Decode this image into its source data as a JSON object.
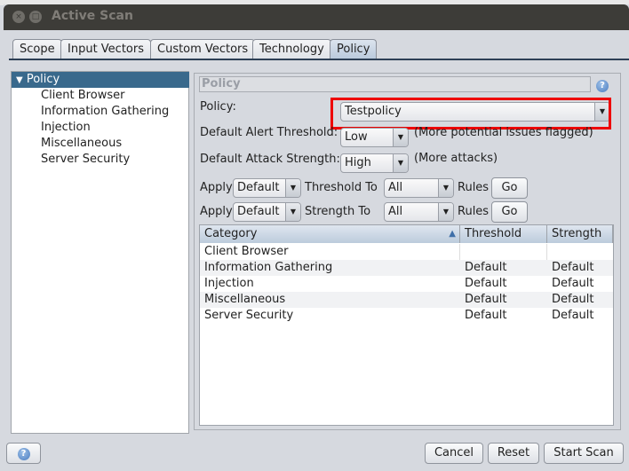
{
  "window": {
    "title": "Active Scan",
    "close_icon": "×",
    "maximize_icon": "□"
  },
  "tabs": [
    {
      "label": "Scope"
    },
    {
      "label": "Input Vectors"
    },
    {
      "label": "Custom Vectors"
    },
    {
      "label": "Technology"
    },
    {
      "label": "Policy",
      "active": true
    }
  ],
  "tree": {
    "root": "Policy",
    "expand_icon": "▼",
    "children": [
      "Client Browser",
      "Information Gathering",
      "Injection",
      "Miscellaneous",
      "Server Security"
    ]
  },
  "panel": {
    "header": "Policy",
    "help_icon": "?",
    "policy_label": "Policy:",
    "policy_value": "Testpolicy",
    "threshold_label": "Default Alert Threshold:",
    "threshold_value": "Low",
    "threshold_note": "(More potential issues flagged)",
    "strength_label": "Default Attack Strength:",
    "strength_value": "High",
    "strength_note": "(More attacks)",
    "apply_threshold": {
      "apply": "Apply",
      "value": "Default",
      "to": "Threshold To",
      "target": "All",
      "rules": "Rules",
      "go": "Go"
    },
    "apply_strength": {
      "apply": "Apply",
      "value": "Default",
      "to": "Strength To",
      "target": "All",
      "rules": "Rules",
      "go": "Go"
    },
    "arrow": "▼"
  },
  "table": {
    "columns": [
      "Category",
      "Threshold",
      "Strength"
    ],
    "sort_icon": "▲",
    "rows": [
      [
        "Client Browser",
        "",
        ""
      ],
      [
        "Information Gathering",
        "Default",
        "Default"
      ],
      [
        "Injection",
        "Default",
        "Default"
      ],
      [
        "Miscellaneous",
        "Default",
        "Default"
      ],
      [
        "Server Security",
        "Default",
        "Default"
      ]
    ]
  },
  "footer": {
    "help_icon": "?",
    "cancel": "Cancel",
    "reset": "Reset",
    "start": "Start Scan"
  },
  "highlight_color": "#ee0000"
}
